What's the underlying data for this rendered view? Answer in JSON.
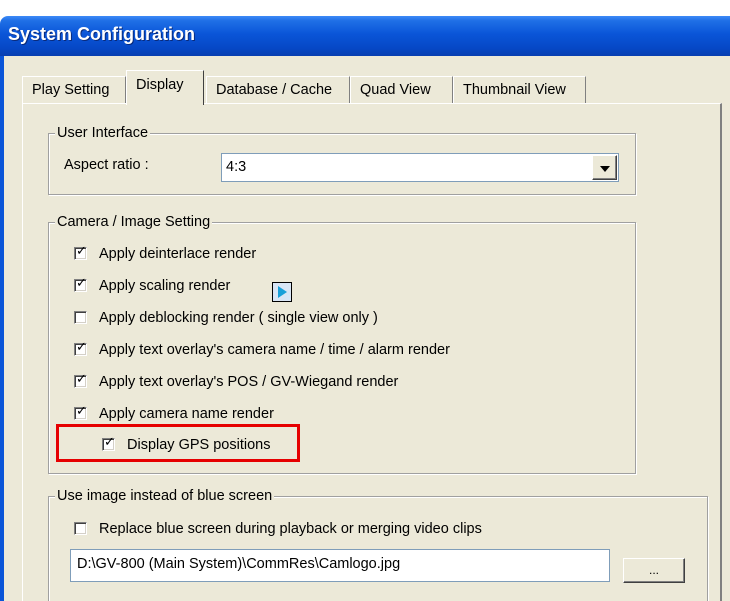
{
  "window": {
    "title": "System Configuration"
  },
  "tabs": [
    {
      "label": "Play Setting",
      "active": false
    },
    {
      "label": "Display",
      "active": true
    },
    {
      "label": "Database / Cache",
      "active": false
    },
    {
      "label": "Quad View",
      "active": false
    },
    {
      "label": "Thumbnail View",
      "active": false
    }
  ],
  "user_interface": {
    "group_title": "User Interface",
    "aspect_label": "Aspect ratio :",
    "aspect_value": "4:3"
  },
  "camera_image": {
    "group_title": "Camera / Image Setting",
    "options": [
      {
        "label": "Apply deinterlace render",
        "checked": true
      },
      {
        "label": "Apply scaling render",
        "checked": true
      },
      {
        "label": "Apply deblocking render ( single view only )",
        "checked": false
      },
      {
        "label": "Apply text overlay's camera name / time / alarm render",
        "checked": true
      },
      {
        "label": "Apply text overlay's POS / GV-Wiegand render",
        "checked": true
      },
      {
        "label": "Apply camera name render",
        "checked": true
      },
      {
        "label": "Display GPS positions",
        "checked": true
      }
    ],
    "scaling_button_icon": "play-arrow-icon"
  },
  "blue_screen": {
    "group_title": "Use image instead of blue screen",
    "replace_label": "Replace blue screen during playback or merging video clips",
    "replace_checked": false,
    "path_value": "D:\\GV-800 (Main System)\\CommRes\\Camlogo.jpg",
    "browse_label": "..."
  },
  "colors": {
    "title_bar": "#0a55d8",
    "dialog_face": "#ece9d8",
    "highlight_box": "#e60000"
  }
}
